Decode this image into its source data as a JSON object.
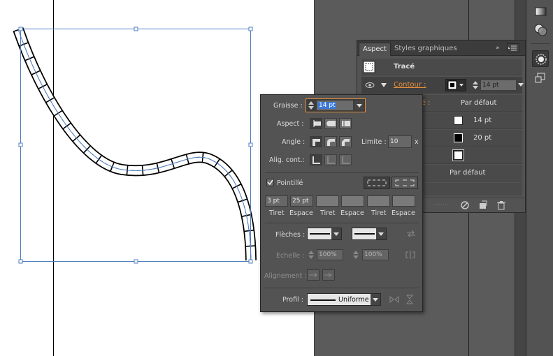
{
  "aspect_panel": {
    "tabs": [
      "Aspect",
      "Styles graphiques"
    ],
    "rows": {
      "trace_label": "Tracé",
      "contour_label": "Contour :",
      "contour_weight": "14 pt",
      "opacity_label": "ité :",
      "opacity_value": "Par défaut",
      "row3_value": "14 pt",
      "row4_value": "20 pt",
      "row6_value": "Par défaut"
    }
  },
  "flyout": {
    "graisse_label": "Graisse :",
    "graisse_value": "14 pt",
    "aspect_label": "Aspect :",
    "angle_label": "Angle :",
    "limite_label": "Limite :",
    "limite_value": "10",
    "limite_unit": "x",
    "align_label": "Alig. cont.:",
    "pointille_label": "Pointillé",
    "pointille_checked": true,
    "dash_values": [
      "3 pt",
      "25 pt",
      "",
      "",
      "",
      ""
    ],
    "dash_labels": [
      "Tiret",
      "Espace",
      "Tiret",
      "Espace",
      "Tiret",
      "Espace"
    ],
    "fleches_label": "Flèches :",
    "echelle_label": "Echelle :",
    "echelle_start": "100%",
    "echelle_end": "100%",
    "alignement_label": "Alignement :",
    "profil_label": "Profil :",
    "profil_value": "Uniforme"
  },
  "colors": {
    "accent_orange": "#e8903c",
    "selection_blue": "#3c78d8",
    "path_guide": "#4c7dbf"
  }
}
